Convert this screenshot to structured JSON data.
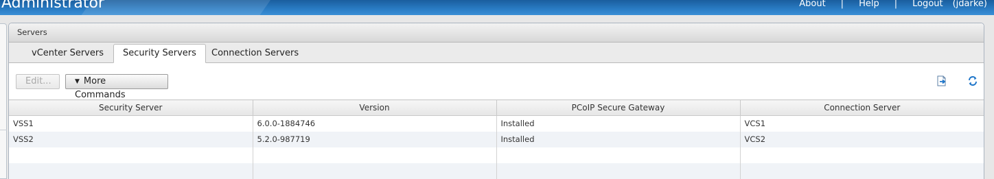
{
  "header": {
    "app_title": "Administrator",
    "links": [
      "About",
      "Help",
      "Logout"
    ],
    "user": "(jdarke)"
  },
  "panel": {
    "title": "Servers",
    "tabs": [
      {
        "label": "vCenter Servers",
        "active": false
      },
      {
        "label": "Security Servers",
        "active": true
      },
      {
        "label": "Connection Servers",
        "active": false
      }
    ]
  },
  "toolbar": {
    "edit_label": "Edit...",
    "more_label": "More Commands",
    "export_icon": "export-icon",
    "refresh_icon": "refresh-icon"
  },
  "table": {
    "columns": [
      "Security Server",
      "Version",
      "PCoIP Secure Gateway",
      "Connection Server"
    ],
    "rows": [
      [
        "VSS1",
        "6.0.0-1884746",
        "Installed",
        "VCS1"
      ],
      [
        "VSS2",
        "5.2.0-987719",
        "Installed",
        "VCS2"
      ]
    ]
  },
  "colors": {
    "banner": "#2a7cc4",
    "tab_bar": "#ebebeb",
    "row_alt": "#f0f3f7",
    "icon_blue": "#1f76c9"
  }
}
